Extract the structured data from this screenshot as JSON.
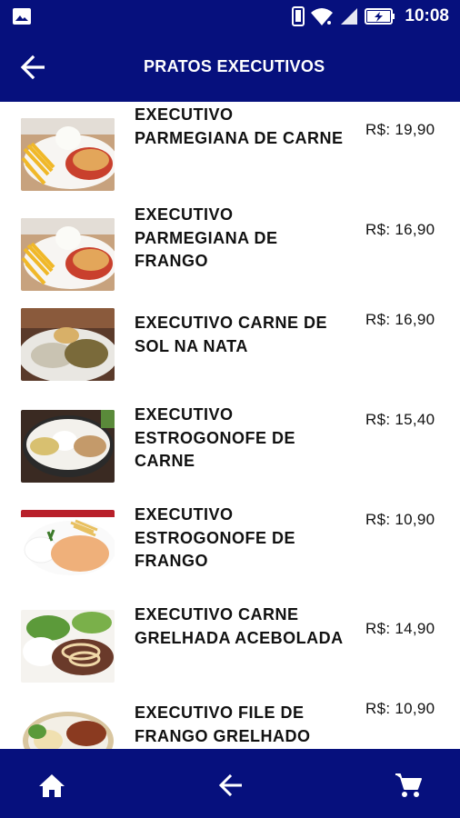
{
  "status_bar": {
    "time": "10:08"
  },
  "header": {
    "title": "PRATOS EXECUTIVOS"
  },
  "items": [
    {
      "name": "EXECUTIVO PARMEGIANA DE CARNE",
      "price": "R$: 19,90"
    },
    {
      "name": "EXECUTIVO PARMEGIANA DE FRANGO",
      "price": "R$: 16,90"
    },
    {
      "name": "EXECUTIVO CARNE DE SOL NA NATA",
      "price": "R$: 16,90"
    },
    {
      "name": "EXECUTIVO ESTROGONOFE DE CARNE",
      "price": "R$: 15,40"
    },
    {
      "name": "EXECUTIVO ESTROGONOFE DE FRANGO",
      "price": "R$: 10,90"
    },
    {
      "name": "EXECUTIVO CARNE GRELHADA ACEBOLADA",
      "price": "R$: 14,90"
    },
    {
      "name": "EXECUTIVO FILE DE FRANGO GRELHADO",
      "price": "R$: 10,90"
    }
  ],
  "bottom_nav": {
    "icons": [
      "home-icon",
      "arrow-back-icon",
      "shopping-cart-icon"
    ]
  },
  "colors": {
    "primary": "#06107d",
    "text": "#111111",
    "background": "#ffffff"
  }
}
